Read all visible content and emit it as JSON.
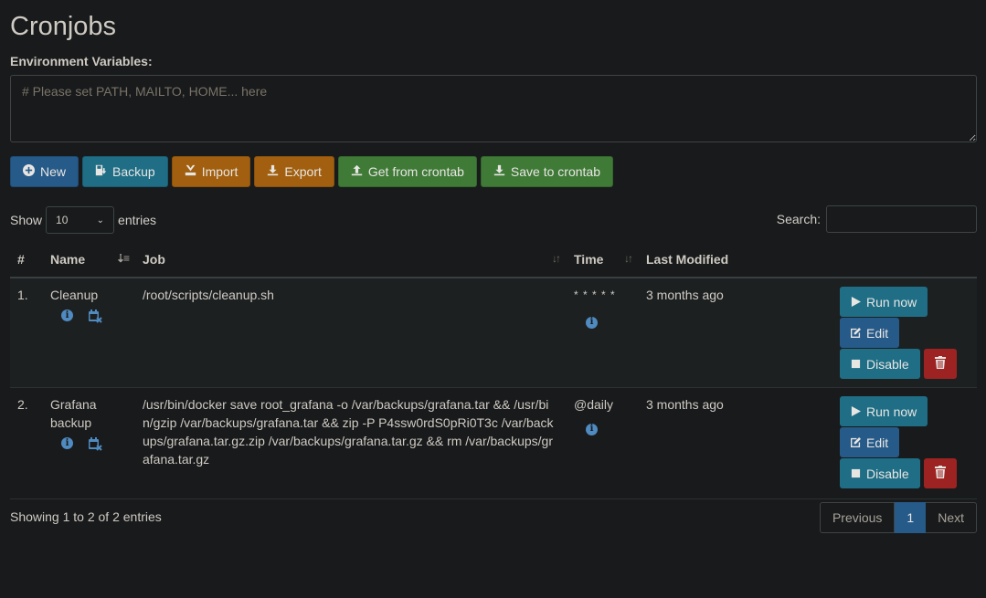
{
  "page": {
    "title": "Cronjobs",
    "env_label": "Environment Variables:",
    "env_placeholder": "# Please set PATH, MAILTO, HOME... here"
  },
  "toolbar": {
    "new": "New",
    "backup": "Backup",
    "import": "Import",
    "export": "Export",
    "get": "Get from crontab",
    "save": "Save to crontab"
  },
  "table_controls": {
    "show_label": "Show",
    "entries_value": "10",
    "entries_label": "entries",
    "search_label": "Search:"
  },
  "columns": {
    "num": "#",
    "name": "Name",
    "job": "Job",
    "time": "Time",
    "modified": "Last Modified"
  },
  "rows": [
    {
      "num": "1.",
      "name": "Cleanup",
      "job": "/root/scripts/cleanup.sh",
      "time": "* * * * *",
      "modified": "3 months ago"
    },
    {
      "num": "2.",
      "name": "Grafana backup",
      "job": "/usr/bin/docker save root_grafana -o /var/backups/grafana.tar && /usr/bin/gzip /var/backups/grafana.tar && zip -P P4ssw0rdS0pRi0T3c /var/backups/grafana.tar.gz.zip /var/backups/grafana.tar.gz && rm /var/backups/grafana.tar.gz",
      "time": "@daily",
      "modified": "3 months ago"
    }
  ],
  "row_actions": {
    "run": "Run now",
    "edit": "Edit",
    "disable": "Disable"
  },
  "footer": {
    "info": "Showing 1 to 2 of 2 entries",
    "previous": "Previous",
    "current_page": "1",
    "next": "Next"
  },
  "colors": {
    "background": "#181a1b",
    "primary": "#265a88",
    "info": "#1f6e86",
    "warning": "#a15f0f",
    "success": "#3f7a37",
    "danger": "#9d2323"
  }
}
